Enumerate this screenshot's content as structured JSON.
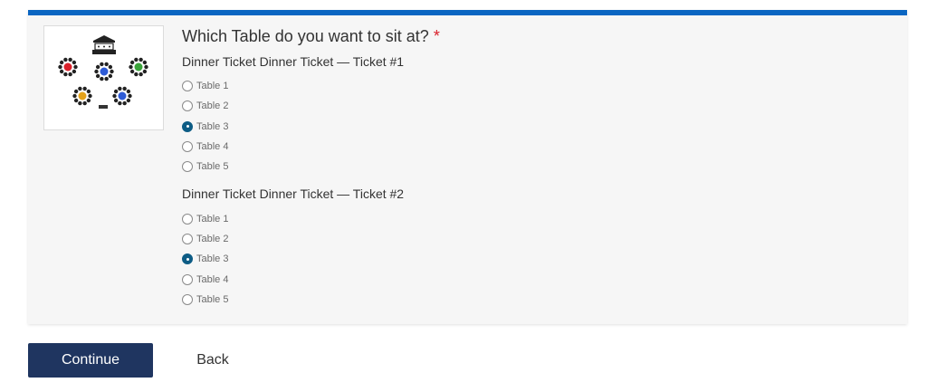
{
  "form": {
    "question": "Which Table do you want to sit at?",
    "required_mark": "*",
    "seat_map_icon": "seating-chart-image",
    "tickets": [
      {
        "title": "Dinner Ticket Dinner Ticket — Ticket #1",
        "options": [
          "Table 1",
          "Table 2",
          "Table 3",
          "Table 4",
          "Table 5"
        ],
        "selected": "Table 3"
      },
      {
        "title": "Dinner Ticket Dinner Ticket — Ticket #2",
        "options": [
          "Table 1",
          "Table 2",
          "Table 3",
          "Table 4",
          "Table 5"
        ],
        "selected": "Table 3"
      }
    ]
  },
  "actions": {
    "continue_label": "Continue",
    "back_label": "Back"
  },
  "colors": {
    "accent_bar": "#0a66c2",
    "primary_button": "#1f3560",
    "radio_checked": "#0d5c85",
    "required": "#d9202a"
  }
}
